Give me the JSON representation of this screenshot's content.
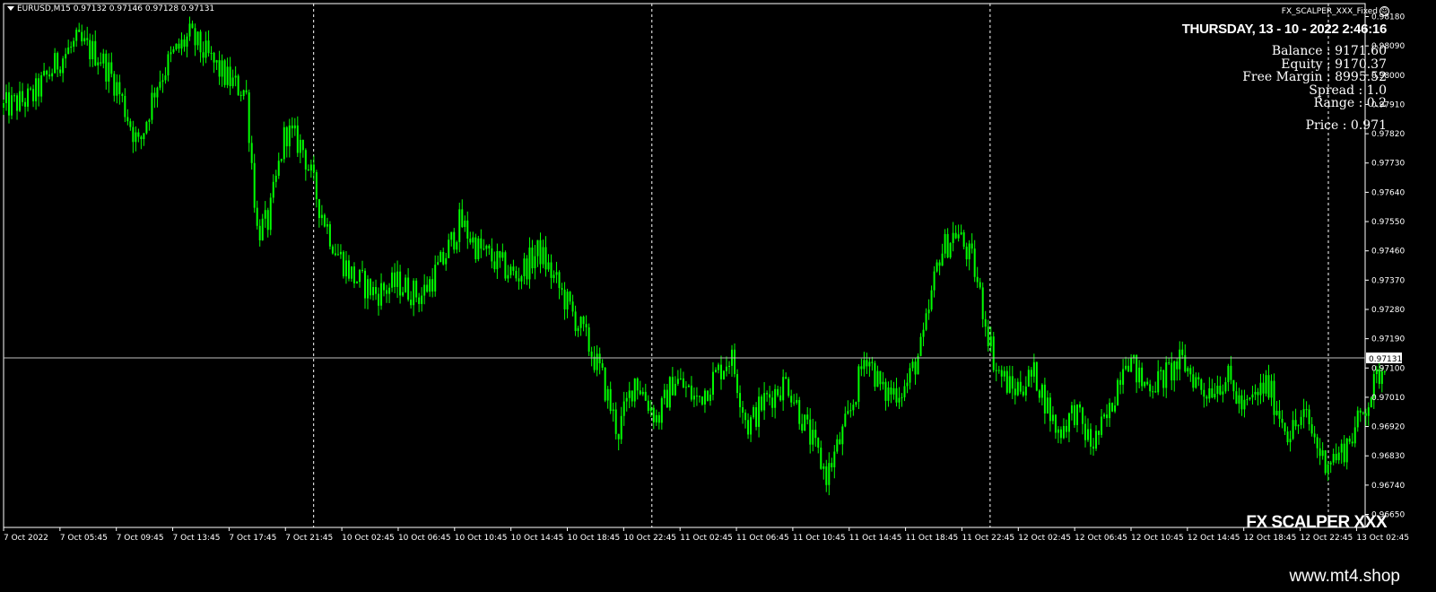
{
  "header": {
    "symbol_info": "EURUSD,M15  0.97132 0.97146 0.97128 0.97131"
  },
  "ea_name": "FX_SCALPER_XXX_Fixed",
  "datetime": "THURSDAY, 13 - 10 - 2022 2:46:16",
  "account": {
    "balance": "Balance   : 9171.60",
    "equity": "Equity    : 9170.37",
    "free_margin": "Free Margin    : 8995.52",
    "spread": "Spread   : 1.0",
    "range": "Range : 0.2",
    "price": "Price : 0.971"
  },
  "brand": "FX SCALPER XXX",
  "watermark": "www.mt4.shop",
  "colors": {
    "background": "#000000",
    "candles": "#00ff00",
    "grid": "#ffffff",
    "text": "#ffffff"
  },
  "chart_data": {
    "type": "candlestick",
    "symbol": "EURUSD",
    "timeframe": "M15",
    "ohlc": {
      "open": 0.97132,
      "high": 0.97146,
      "low": 0.97128,
      "close": 0.97131
    },
    "current_price": 0.97131,
    "current_price_label": "0.97131",
    "ylim": [
      0.9661,
      0.9822
    ],
    "y_ticks": [
      0.9818,
      0.9809,
      0.98,
      0.9791,
      0.9782,
      0.9773,
      0.9764,
      0.9755,
      0.9746,
      0.9737,
      0.9728,
      0.9719,
      0.971,
      0.9701,
      0.9692,
      0.9683,
      0.9674,
      0.9665
    ],
    "y_tick_labels": [
      "0.98180",
      "0.98090",
      "0.98000",
      "0.97910",
      "0.97820",
      "0.97730",
      "0.97640",
      "0.97550",
      "0.97460",
      "0.97370",
      "0.97280",
      "0.97190",
      "0.97100",
      "0.97010",
      "0.96920",
      "0.96830",
      "0.96740",
      "0.96650"
    ],
    "x_tick_labels": [
      "7 Oct 2022",
      "7 Oct 05:45",
      "7 Oct 09:45",
      "7 Oct 13:45",
      "7 Oct 17:45",
      "7 Oct 21:45",
      "10 Oct 02:45",
      "10 Oct 06:45",
      "10 Oct 10:45",
      "10 Oct 14:45",
      "10 Oct 18:45",
      "10 Oct 22:45",
      "11 Oct 02:45",
      "11 Oct 06:45",
      "11 Oct 10:45",
      "11 Oct 14:45",
      "11 Oct 18:45",
      "11 Oct 22:45",
      "12 Oct 02:45",
      "12 Oct 06:45",
      "12 Oct 10:45",
      "12 Oct 14:45",
      "12 Oct 18:45",
      "12 Oct 22:45",
      "13 Oct 02:45"
    ],
    "day_separator_ticks": [
      5.5,
      11.5,
      17.5,
      23.5
    ],
    "close_path": [
      [
        0,
        0.979
      ],
      [
        0.5,
        0.9793
      ],
      [
        1.0,
        0.9805
      ],
      [
        1.3,
        0.981
      ],
      [
        1.7,
        0.9806
      ],
      [
        2.0,
        0.9797
      ],
      [
        2.4,
        0.9778
      ],
      [
        2.7,
        0.9797
      ],
      [
        3.0,
        0.9806
      ],
      [
        3.3,
        0.9812
      ],
      [
        3.6,
        0.9806
      ],
      [
        3.9,
        0.98
      ],
      [
        4.1,
        0.9797
      ],
      [
        4.3,
        0.9795
      ],
      [
        4.5,
        0.9752
      ],
      [
        4.7,
        0.9755
      ],
      [
        5.0,
        0.9783
      ],
      [
        5.3,
        0.9778
      ],
      [
        5.6,
        0.976
      ],
      [
        5.9,
        0.9746
      ],
      [
        6.2,
        0.9738
      ],
      [
        6.6,
        0.9733
      ],
      [
        7.0,
        0.9736
      ],
      [
        7.4,
        0.9732
      ],
      [
        7.8,
        0.9743
      ],
      [
        8.1,
        0.9755
      ],
      [
        8.4,
        0.9747
      ],
      [
        8.7,
        0.9743
      ],
      [
        9.1,
        0.9738
      ],
      [
        9.5,
        0.9746
      ],
      [
        9.9,
        0.9733
      ],
      [
        10.3,
        0.972
      ],
      [
        10.6,
        0.9708
      ],
      [
        10.9,
        0.969
      ],
      [
        11.2,
        0.9707
      ],
      [
        11.6,
        0.9694
      ],
      [
        11.9,
        0.9707
      ],
      [
        12.3,
        0.97
      ],
      [
        12.6,
        0.9707
      ],
      [
        12.9,
        0.9714
      ],
      [
        13.2,
        0.9692
      ],
      [
        13.5,
        0.97
      ],
      [
        13.9,
        0.9706
      ],
      [
        14.2,
        0.9693
      ],
      [
        14.6,
        0.9677
      ],
      [
        15.0,
        0.9695
      ],
      [
        15.3,
        0.9715
      ],
      [
        15.6,
        0.9702
      ],
      [
        16.0,
        0.9704
      ],
      [
        16.3,
        0.9717
      ],
      [
        16.6,
        0.9745
      ],
      [
        16.9,
        0.9752
      ],
      [
        17.2,
        0.9742
      ],
      [
        17.6,
        0.971
      ],
      [
        17.9,
        0.9703
      ],
      [
        18.3,
        0.9708
      ],
      [
        18.7,
        0.969
      ],
      [
        19.0,
        0.9697
      ],
      [
        19.3,
        0.9686
      ],
      [
        19.6,
        0.9695
      ],
      [
        19.9,
        0.9715
      ],
      [
        20.2,
        0.9705
      ],
      [
        20.5,
        0.9706
      ],
      [
        20.9,
        0.9712
      ],
      [
        21.3,
        0.9703
      ],
      [
        21.7,
        0.9707
      ],
      [
        22.0,
        0.9697
      ],
      [
        22.4,
        0.9705
      ],
      [
        22.8,
        0.969
      ],
      [
        23.1,
        0.9695
      ],
      [
        23.4,
        0.9682
      ],
      [
        23.7,
        0.9683
      ],
      [
        24.0,
        0.9692
      ],
      [
        24.5,
        0.9712
      ]
    ]
  }
}
